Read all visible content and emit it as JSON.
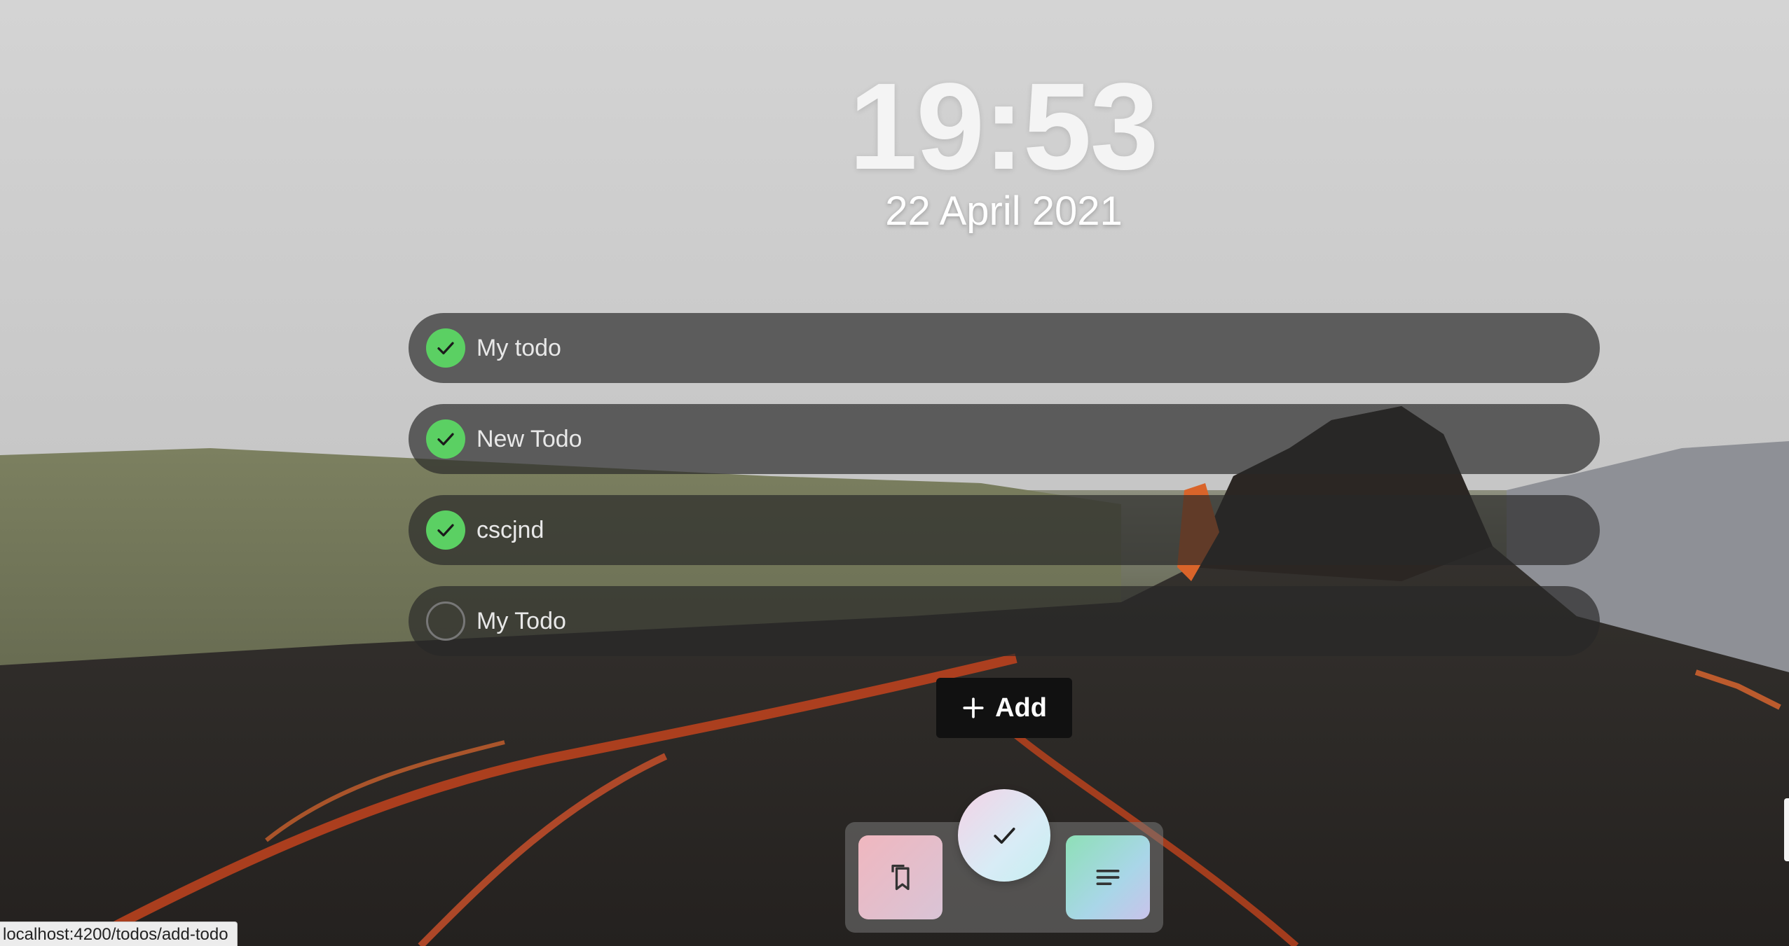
{
  "clock": {
    "time": "19:53",
    "date": "22 April 2021"
  },
  "todos": [
    {
      "label": "My todo",
      "done": true
    },
    {
      "label": "New Todo",
      "done": true
    },
    {
      "label": "cscjnd",
      "done": true
    },
    {
      "label": "My Todo",
      "done": false
    }
  ],
  "add_button": {
    "label": "Add",
    "icon": "plus-icon"
  },
  "dock": {
    "left_icon": "bookmarks-icon",
    "center_icon": "check-icon",
    "right_icon": "notes-icon"
  },
  "status_bar": {
    "url": "localhost:4200/todos/add-todo"
  },
  "colors": {
    "done": "#5bd063",
    "todo_bg": "#282828"
  }
}
